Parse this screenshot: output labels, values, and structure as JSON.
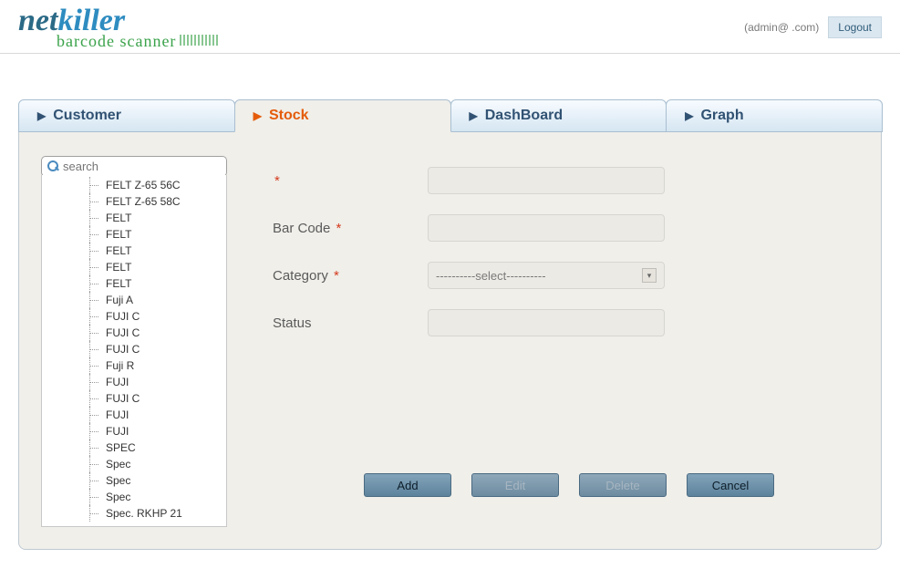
{
  "header": {
    "logo_net": "net",
    "logo_killer": "killer",
    "logo_sub": "barcode scanner",
    "user_email": "(admin@               .com)",
    "logout_label": "Logout"
  },
  "tabs": {
    "customer": "Customer",
    "stock": "Stock",
    "dashboard": "DashBoard",
    "graph": "Graph"
  },
  "sidebar": {
    "search_placeholder": "search",
    "tree_items": [
      "FELT Z-65 56C",
      "FELT Z-65 58C",
      "FELT",
      "FELT",
      "FELT",
      "FELT",
      "FELT",
      "Fuji A",
      "FUJI             C",
      "FUJI             C",
      "FUJI             C",
      "Fuji R",
      "FUJI",
      "FUJI            C",
      "FUJI",
      "FUJI",
      "SPEC",
      "Spec",
      "Spec",
      "Spec",
      "Spec. RKHP 21"
    ]
  },
  "form": {
    "field1_label": " ",
    "barcode_label": "Bar Code",
    "category_label": "Category",
    "category_placeholder": "----------select----------",
    "status_label": "Status"
  },
  "buttons": {
    "add": "Add",
    "edit": "Edit",
    "delete": "Delete",
    "cancel": "Cancel"
  }
}
